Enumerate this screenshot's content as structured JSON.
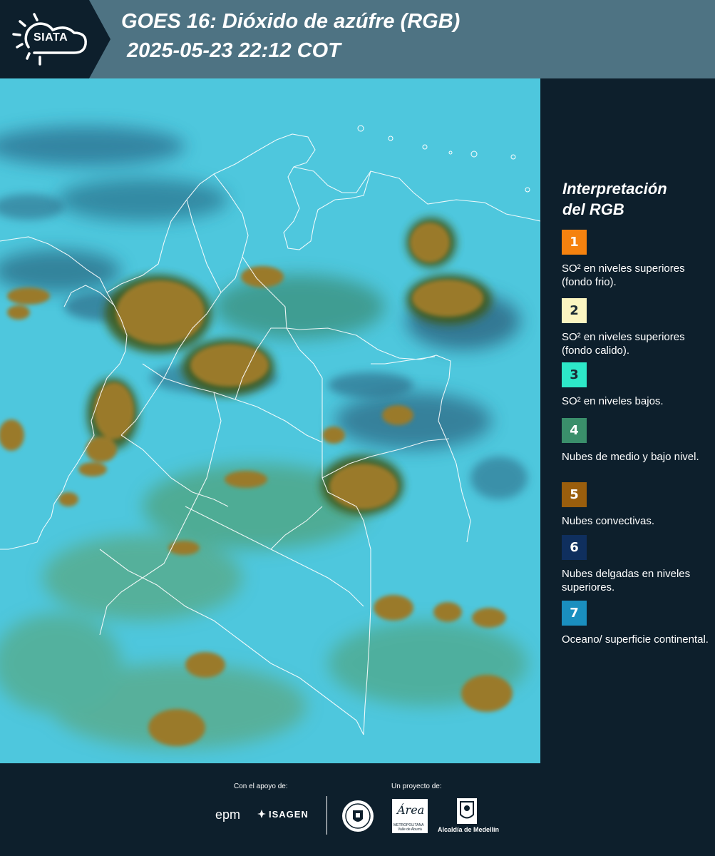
{
  "header": {
    "logo_text": "SIATA",
    "title_line1": "GOES 16: Dióxido de azúfre (RGB)",
    "title_line2": "2025-05-23 22:12 COT"
  },
  "legend": {
    "title_line1": "Interpretación",
    "title_line2": "del RGB",
    "items": [
      {
        "number": "1",
        "color": "#f5820f",
        "label": "SO² en niveles superiores (fondo frio)."
      },
      {
        "number": "2",
        "color": "#fbf5c1",
        "label": "SO² en niveles superiores (fondo calido)."
      },
      {
        "number": "3",
        "color": "#2de8c8",
        "label": "SO² en niveles bajos."
      },
      {
        "number": "4",
        "color": "#3a8f6b",
        "label": "Nubes de medio y bajo nivel."
      },
      {
        "number": "5",
        "color": "#9a5e0d",
        "label": "Nubes convectivas."
      },
      {
        "number": "6",
        "color": "#0f2f5e",
        "label": "Nubes delgadas en niveles superiores."
      },
      {
        "number": "7",
        "color": "#1a8fbf",
        "label": "Oceano/ superficie continental."
      }
    ]
  },
  "footer": {
    "support_label": "Con el apoyo de:",
    "project_label": "Un proyecto de:",
    "logos": [
      "epm",
      "ISAGEN",
      "Concejo de Medellín seal",
      "Área Metropolitana Valle de Aburrá",
      "Alcaldía de Medellín"
    ],
    "epm_text": "epm",
    "isagen_text": "ISAGEN",
    "area_text": "Área",
    "area_sub1": "METROPOLITANA",
    "area_sub2": "Valle de Aburrá",
    "alcaldia_text": "Alcaldía de Medellín"
  }
}
